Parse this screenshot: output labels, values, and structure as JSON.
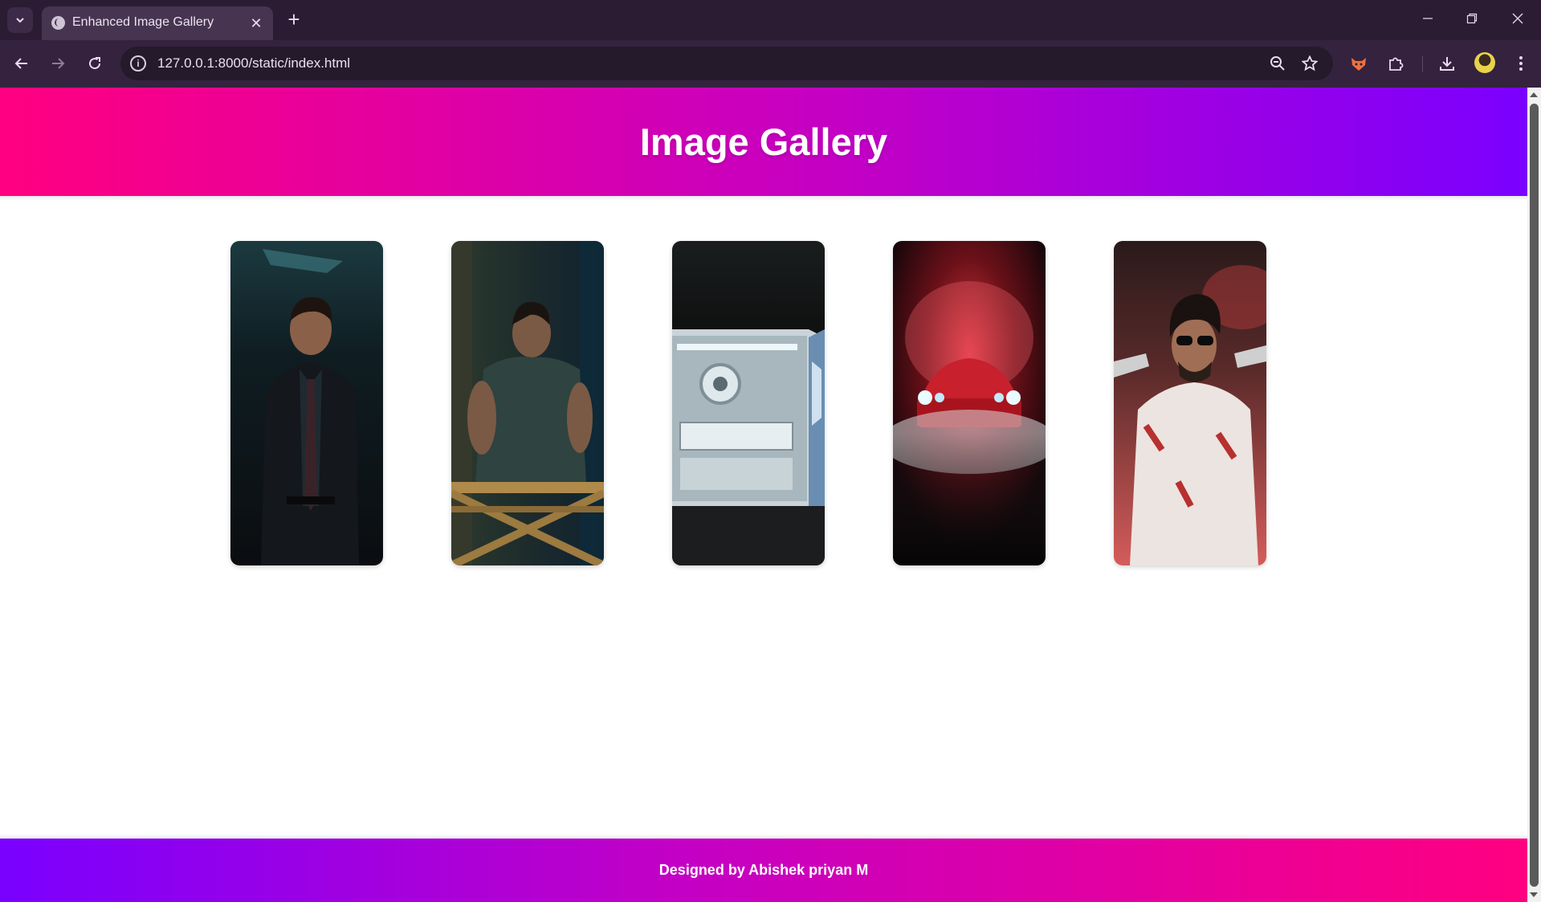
{
  "browser": {
    "tab_title": "Enhanced Image Gallery",
    "url": "127.0.0.1:8000/static/index.html"
  },
  "page": {
    "heading": "Image Gallery",
    "footer": "Designed by Abishek priyan M"
  },
  "gallery": {
    "images": [
      {
        "name": "man-in-dark-suit-and-tie"
      },
      {
        "name": "muscular-man-leaning-on-wooden-railing"
      },
      {
        "name": "white-gaming-pc-case-with-lights"
      },
      {
        "name": "red-muscle-car-in-smoke"
      },
      {
        "name": "man-in-sunglasses-with-red-smoke"
      }
    ]
  },
  "colors": {
    "header_gradient": [
      "#ff0080",
      "#c400c4",
      "#7a00ff"
    ],
    "footer_gradient": [
      "#7a00ff",
      "#c400c4",
      "#ff0080"
    ],
    "chrome_bg": "#35223f"
  },
  "icons": [
    "tab-search-icon",
    "globe-icon",
    "close-icon",
    "plus-icon",
    "minimize-icon",
    "restore-icon",
    "back-icon",
    "forward-icon",
    "reload-icon",
    "site-info-icon",
    "zoom-icon",
    "star-icon",
    "fox-extension-icon",
    "puzzle-icon",
    "download-icon",
    "menu-icon"
  ]
}
